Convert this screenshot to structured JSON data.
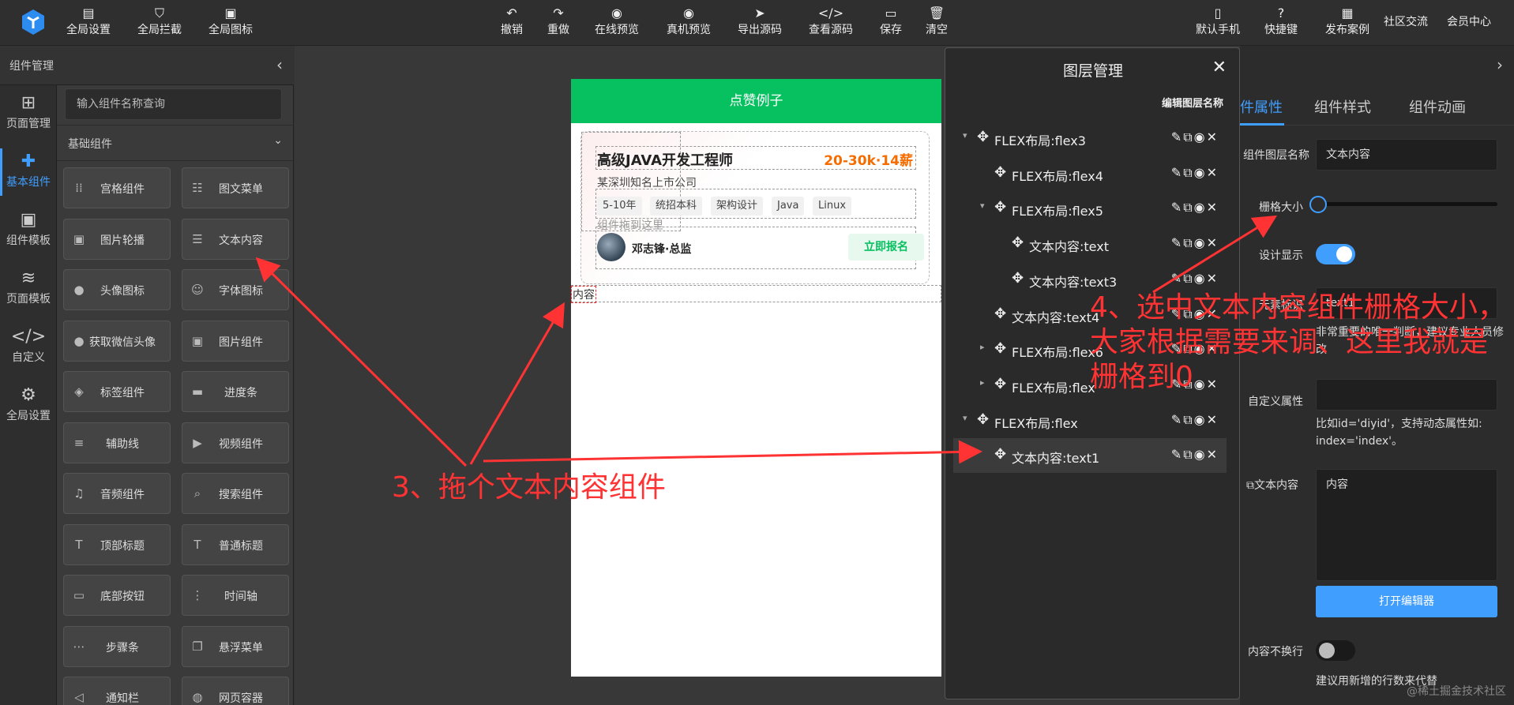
{
  "colors": {
    "accent": "#409eff",
    "brand_green": "#07c160",
    "annotation": "#ff3333",
    "salary": "#f56c00"
  },
  "topbar": {
    "left_buttons": [
      {
        "label": "全局设置",
        "icon": "settings-doc-icon"
      },
      {
        "label": "全局拦截",
        "icon": "shield-icon"
      },
      {
        "label": "全局图标",
        "icon": "image-grid-icon"
      }
    ],
    "center_buttons": [
      {
        "label": "撤销",
        "icon": "undo-icon"
      },
      {
        "label": "重做",
        "icon": "redo-icon"
      },
      {
        "label": "在线预览",
        "icon": "eye-icon"
      },
      {
        "label": "真机预览",
        "icon": "eye-icon"
      },
      {
        "label": "导出源码",
        "icon": "send-icon"
      },
      {
        "label": "查看源码",
        "icon": "code-icon"
      },
      {
        "label": "保存",
        "icon": "save-icon"
      },
      {
        "label": "清空",
        "icon": "trash-icon"
      }
    ],
    "right_buttons": [
      {
        "label": "默认手机",
        "icon": "phone-icon"
      },
      {
        "label": "快捷键",
        "icon": "help-icon"
      },
      {
        "label": "发布案例",
        "icon": "publish-icon"
      }
    ],
    "links": [
      "社区交流",
      "会员中心"
    ]
  },
  "leftnav": {
    "items": [
      {
        "label": "页面管理",
        "icon": "layout-icon"
      },
      {
        "label": "基本组件",
        "icon": "puzzle-icon"
      },
      {
        "label": "组件模板",
        "icon": "template-icon"
      },
      {
        "label": "页面模板",
        "icon": "database-icon"
      },
      {
        "label": "自定义",
        "icon": "code-icon"
      },
      {
        "label": "全局设置",
        "icon": "gear-icon"
      }
    ]
  },
  "component_panel": {
    "title": "组件管理",
    "search_placeholder": "输入组件名称查询",
    "group_title": "基础组件",
    "components": [
      {
        "label": "宫格组件",
        "icon": "grid-icon"
      },
      {
        "label": "图文菜单",
        "icon": "list-icon"
      },
      {
        "label": "图片轮播",
        "icon": "image-icon"
      },
      {
        "label": "文本内容",
        "icon": "text-icon"
      },
      {
        "label": "头像图标",
        "icon": "user-icon"
      },
      {
        "label": "字体图标",
        "icon": "smile-icon"
      },
      {
        "label": "获取微信头像",
        "icon": "user-icon"
      },
      {
        "label": "图片组件",
        "icon": "image-icon"
      },
      {
        "label": "标签组件",
        "icon": "tag-icon"
      },
      {
        "label": "进度条",
        "icon": "progress-icon"
      },
      {
        "label": "辅助线",
        "icon": "lines-icon"
      },
      {
        "label": "视频组件",
        "icon": "video-icon"
      },
      {
        "label": "音频组件",
        "icon": "music-icon"
      },
      {
        "label": "搜索组件",
        "icon": "search-icon"
      },
      {
        "label": "顶部标题",
        "icon": "title-icon"
      },
      {
        "label": "普通标题",
        "icon": "title-icon"
      },
      {
        "label": "底部按钮",
        "icon": "bottom-bar-icon"
      },
      {
        "label": "时间轴",
        "icon": "timeline-icon"
      },
      {
        "label": "步骤条",
        "icon": "steps-icon"
      },
      {
        "label": "悬浮菜单",
        "icon": "float-icon"
      },
      {
        "label": "通知栏",
        "icon": "speaker-icon"
      },
      {
        "label": "网页容器",
        "icon": "globe-icon"
      }
    ]
  },
  "phone": {
    "header_title": "点赞例子",
    "job_title": "高级JAVA开发工程师",
    "salary": "20-30k·14薪",
    "company": "某深圳知名上市公司",
    "tags": [
      "5-10年",
      "统招本科",
      "架构设计",
      "Java",
      "Linux"
    ],
    "drop_hint": "组件拖到这里",
    "recruiter": "邓志锋·总监",
    "apply_label": "立即报名",
    "content_text": "内容"
  },
  "layer_panel": {
    "title": "图层管理",
    "edit_name_label": "编辑图层名称",
    "rows": [
      {
        "name": "FLEX布局:flex3",
        "arrow": "▾"
      },
      {
        "name": "FLEX布局:flex4",
        "arrow": ""
      },
      {
        "name": "FLEX布局:flex5",
        "arrow": "▾"
      },
      {
        "name": "文本内容:text",
        "arrow": ""
      },
      {
        "name": "文本内容:text3",
        "arrow": ""
      },
      {
        "name": "文本内容:text4",
        "arrow": ""
      },
      {
        "name": "FLEX布局:flex6",
        "arrow": "▸"
      },
      {
        "name": "FLEX布局:flex",
        "arrow": "▸"
      },
      {
        "name": "FLEX布局:flex",
        "arrow": "▾"
      },
      {
        "name": "文本内容:text1",
        "arrow": ""
      }
    ],
    "selected_index": 9
  },
  "prop_panel": {
    "tabs": [
      "件属性",
      "组件样式",
      "组件动画"
    ],
    "layer_name_label": "组件图层名称",
    "layer_name_value": "文本内容",
    "grid_size_label": "栅格大小",
    "grid_size_value": 0,
    "design_display_label": "设计显示",
    "design_display_on": true,
    "id_label": "元素标识",
    "id_value": "text1",
    "id_hint": "非常重要的唯一判断，建议专业人员修改",
    "custom_attr_label": "自定义属性",
    "custom_attr_hint": "比如id='diyid'，支持动态属性如: index='index'。",
    "text_content_label": "文本内容",
    "text_content_value": "内容",
    "open_editor_label": "打开编辑器",
    "nowrap_label": "内容不换行",
    "nowrap_on": false,
    "bottom_hint": "建议用新增的行数来代替"
  },
  "annotations": {
    "step3": "3、拖个文本内容组件",
    "step4": "4、选中文本内容组件栅格大小，大家根据需要来调、这里我就是栅格到0"
  },
  "watermark": "@稀土掘金技术社区"
}
